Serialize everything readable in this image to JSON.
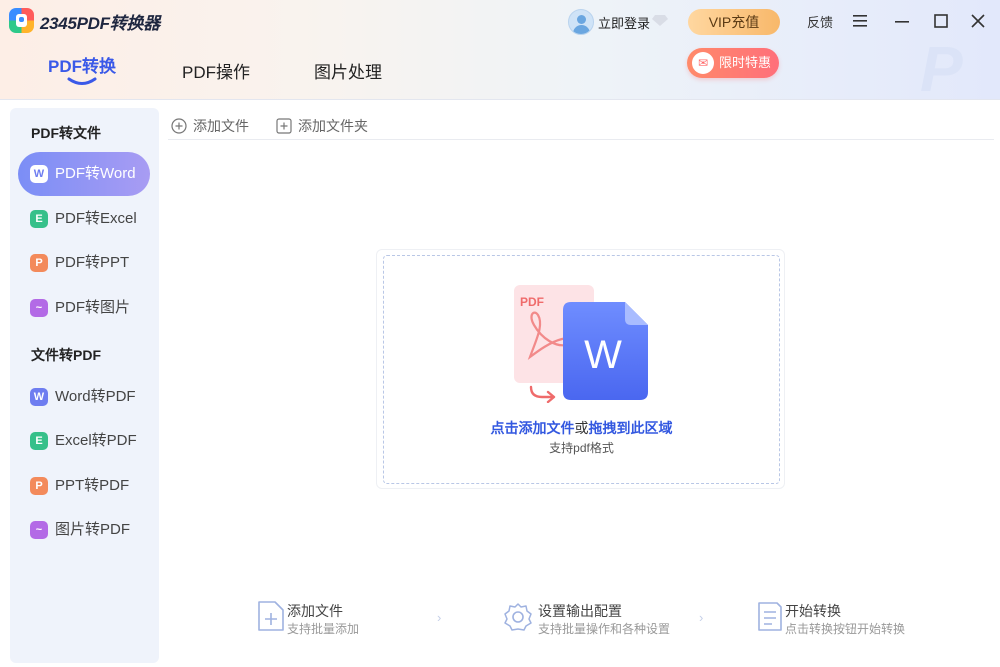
{
  "app": {
    "name": "2345PDF转换器",
    "login_label": "立即登录",
    "vip_label": "VIP充值",
    "feedback_label": "反馈",
    "promo_label": "限时特惠",
    "promo_icon": "gift-icon"
  },
  "tabs": [
    {
      "label": "PDF转换",
      "active": true
    },
    {
      "label": "PDF操作",
      "active": false
    },
    {
      "label": "图片处理",
      "active": false
    }
  ],
  "sidebar": {
    "section1_title": "PDF转文件",
    "section2_title": "文件转PDF",
    "items": [
      {
        "label": "PDF转Word",
        "icon_letter": "W",
        "color": "#6e7df0",
        "active": true
      },
      {
        "label": "PDF转Excel",
        "icon_letter": "E",
        "color": "#36c08a",
        "active": false
      },
      {
        "label": "PDF转PPT",
        "icon_letter": "P",
        "color": "#f38a5b",
        "active": false
      },
      {
        "label": "PDF转图片",
        "icon_letter": "~",
        "color": "#b36ae6",
        "active": false
      },
      {
        "label": "Word转PDF",
        "icon_letter": "W",
        "color": "#6e7df0",
        "active": false
      },
      {
        "label": "Excel转PDF",
        "icon_letter": "E",
        "color": "#36c08a",
        "active": false
      },
      {
        "label": "PPT转PDF",
        "icon_letter": "P",
        "color": "#f38a5b",
        "active": false
      },
      {
        "label": "图片转PDF",
        "icon_letter": "~",
        "color": "#b36ae6",
        "active": false
      }
    ]
  },
  "toolbar": {
    "add_file": "添加文件",
    "add_folder": "添加文件夹"
  },
  "dropzone": {
    "pdf_tag": "PDF",
    "word_letter": "W",
    "link1": "点击添加文件",
    "or": "或",
    "link2": "拖拽到此区域",
    "sub": "支持pdf格式"
  },
  "steps": [
    {
      "title": "添加文件",
      "sub": "支持批量添加",
      "icon": "add-document-icon"
    },
    {
      "title": "设置输出配置",
      "sub": "支持批量操作和各种设置",
      "icon": "settings-gear-icon"
    },
    {
      "title": "开始转换",
      "sub": "点击转换按钮开始转换",
      "icon": "convert-document-icon"
    }
  ],
  "colors": {
    "accent": "#3a59e8",
    "vip": "#f8b86a",
    "promo": "#ff6f7a",
    "sidebar_bg": "#eff3fb"
  }
}
